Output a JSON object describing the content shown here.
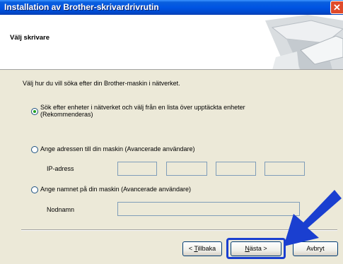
{
  "window": {
    "title": "Installation av Brother-skrivardrivrutin",
    "close_glyph": "✕"
  },
  "header": {
    "title": "Välj skrivare"
  },
  "instruction": "Välj hur du vill söka efter din Brother-maskin i nätverket.",
  "options": [
    {
      "line1": "Sök efter enheter i nätverket och välj från en lista över upptäckta enheter",
      "line2": "(Rekommenderas)",
      "checked": true
    },
    {
      "label": "Ange adressen till din maskin (Avancerade användare)",
      "checked": false
    },
    {
      "label": "Ange namnet på din maskin (Avancerade användare)",
      "checked": false
    }
  ],
  "ip_label": "IP-adress",
  "ip_octets": [
    "",
    "",
    "",
    ""
  ],
  "node_label": "Nodnamn",
  "node_value": "",
  "buttons": {
    "back_prefix": "< ",
    "back_accel": "T",
    "back_rest": "illbaka",
    "next_accel": "N",
    "next_rest": "ästa >",
    "cancel": "Avbryt"
  },
  "colors": {
    "annotation": "#1a3fd0",
    "titlebar": "#0054e3"
  }
}
